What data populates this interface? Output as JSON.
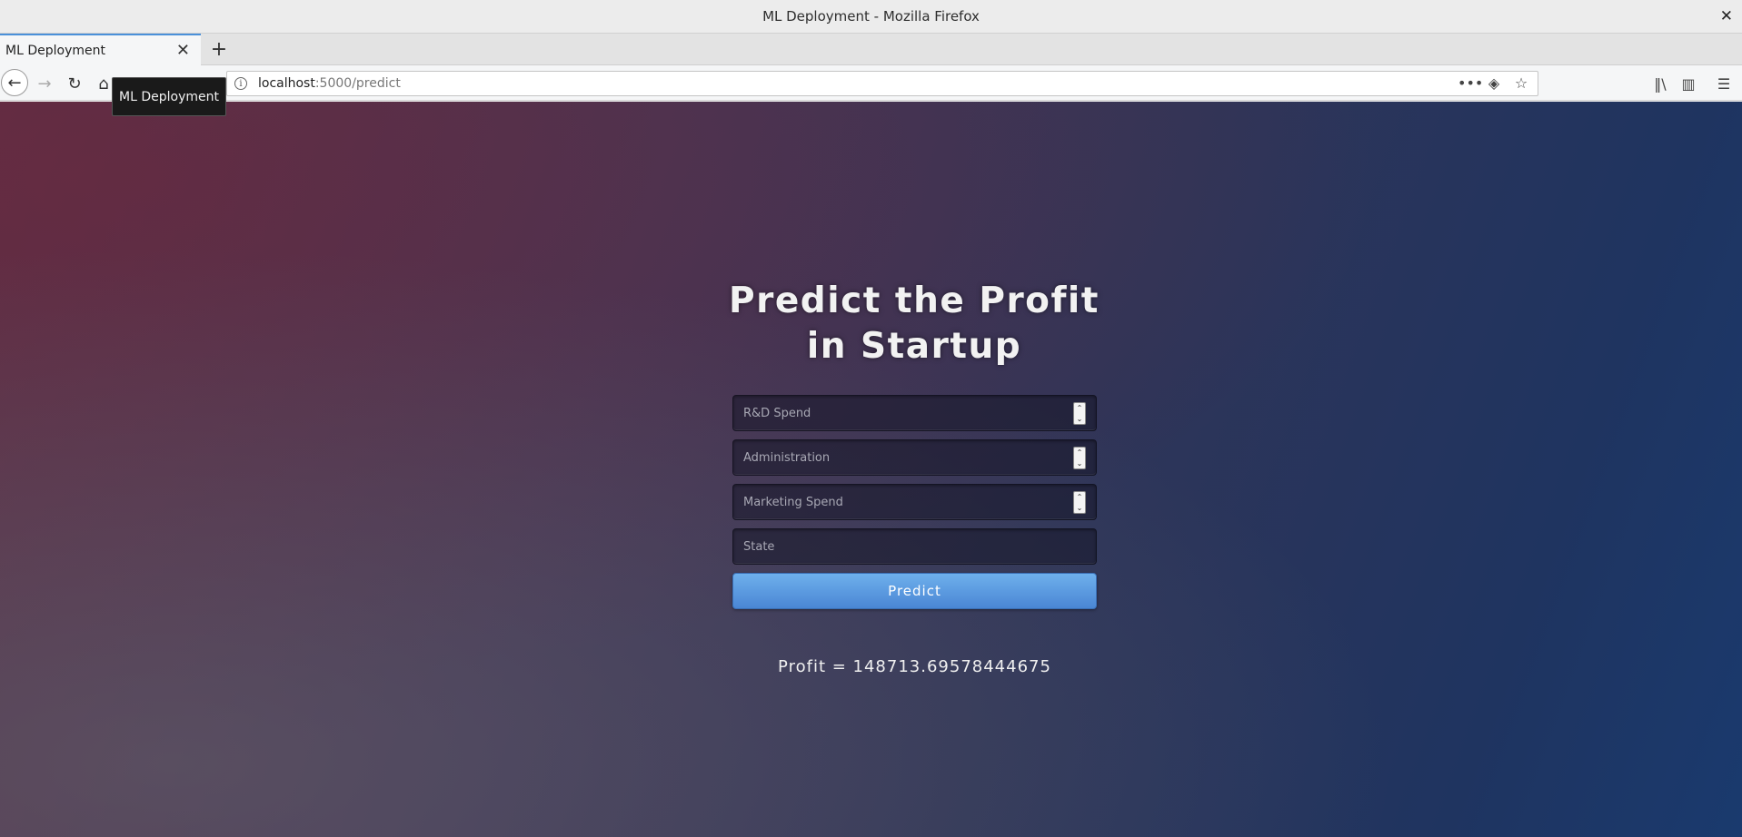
{
  "window": {
    "title": "ML Deployment - Mozilla Firefox",
    "close_glyph": "✕"
  },
  "tabs": [
    {
      "label": "ML Deployment"
    }
  ],
  "tab_close_glyph": "✕",
  "new_tab_glyph": "+",
  "nav": {
    "back_glyph": "←",
    "forward_glyph": "→",
    "reload_glyph": "↻",
    "home_glyph": "⌂"
  },
  "address": {
    "info_glyph": "i",
    "host": "localhost",
    "path": ":5000/predict",
    "actions": [
      "•••",
      "◈",
      "☆"
    ]
  },
  "toolbar_right": [
    "‖\\",
    "▥",
    "☰"
  ],
  "tooltip": "ML Deployment",
  "page": {
    "heading": "Predict the Profit in Startup",
    "fields": [
      {
        "placeholder": "R&D Spend",
        "type": "number"
      },
      {
        "placeholder": "Administration",
        "type": "number"
      },
      {
        "placeholder": "Marketing Spend",
        "type": "number"
      },
      {
        "placeholder": "State",
        "type": "text"
      }
    ],
    "spinner_up": "⌃",
    "spinner_down": "⌄",
    "predict_label": "Predict",
    "result": "Profit = 148713.69578444675"
  },
  "icons": {
    "back": "arrow-left-icon",
    "forward": "arrow-right-icon",
    "reload": "reload-icon",
    "home": "home-icon",
    "info": "info-icon",
    "page_actions": "more-icon",
    "pocket": "pocket-icon",
    "bookmark": "star-icon",
    "library": "library-icon",
    "sidebar": "sidebar-icon",
    "menu": "hamburger-menu-icon"
  },
  "colors": {
    "accent": "#4a90d9",
    "button": "#4a86d4",
    "bg_left": "#5a2f47",
    "bg_right": "#1a3a6e"
  }
}
